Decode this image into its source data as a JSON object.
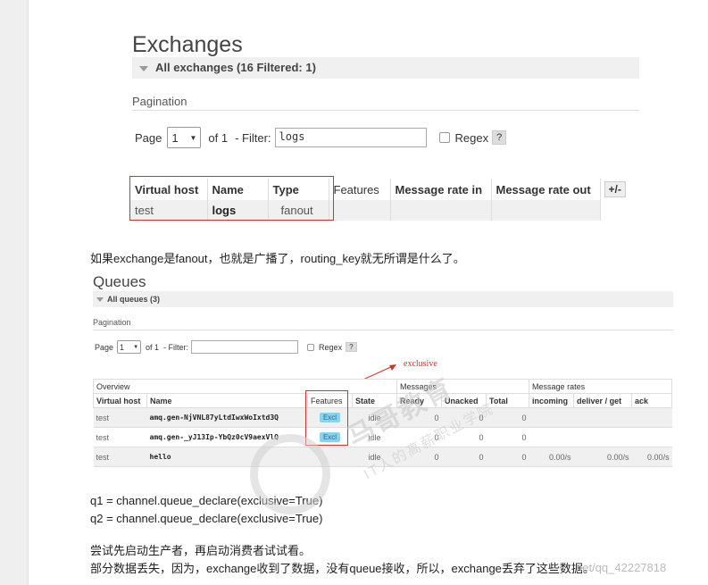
{
  "exchanges": {
    "title": "Exchanges",
    "filter_summary": "All exchanges (16 Filtered: 1)",
    "pagination_label": "Pagination",
    "page_label": "Page",
    "page_value": "1",
    "of_label": "of 1",
    "filter_label": "- Filter:",
    "filter_value": "logs",
    "regex_label": "Regex",
    "help_label": "?",
    "columns": [
      "Virtual host",
      "Name",
      "Type",
      "Features",
      "Message rate in",
      "Message rate out"
    ],
    "plus_minus": "+/-",
    "row": {
      "vhost": "test",
      "name": "logs",
      "type": "fanout",
      "features": "",
      "rate_in": "",
      "rate_out": ""
    }
  },
  "note1": "如果exchange是fanout，也就是广播了，routing_key就无所谓是什么了。",
  "queues": {
    "title": "Queues",
    "filter_summary": "All queues (3)",
    "pagination_label": "Pagination",
    "page_label": "Page",
    "page_value": "1",
    "of_label": "of 1",
    "filter_label": "- Filter:",
    "filter_value": "",
    "regex_label": "Regex",
    "help_label": "?",
    "groups": {
      "overview": "Overview",
      "messages": "Messages",
      "rates": "Message rates"
    },
    "columns": [
      "Virtual host",
      "Name",
      "Features",
      "State",
      "Ready",
      "Unacked",
      "Total",
      "incoming",
      "deliver / get",
      "ack"
    ],
    "rows": [
      {
        "vhost": "test",
        "name": "amq.gen-NjVNL87yLtdIwxWoIxtd3Q",
        "feature": "Excl",
        "state": "idle",
        "ready": "0",
        "unacked": "0",
        "total": "0",
        "incoming": "",
        "deliver": "",
        "ack": ""
      },
      {
        "vhost": "test",
        "name": "amq.gen-_yJ13Ip-YbQz0cV9aexVlQ",
        "feature": "Excl",
        "state": "idle",
        "ready": "0",
        "unacked": "0",
        "total": "0",
        "incoming": "",
        "deliver": "",
        "ack": ""
      },
      {
        "vhost": "test",
        "name": "hello",
        "feature": "",
        "state": "idle",
        "ready": "0",
        "unacked": "0",
        "total": "0",
        "incoming": "0.00/s",
        "deliver": "0.00/s",
        "ack": "0.00/s"
      }
    ],
    "annotation": "exclusive"
  },
  "code_lines": [
    "q1 = channel.queue_declare(exclusive=True)",
    "q2 = channel.queue_declare(exclusive=True)"
  ],
  "note2": "尝试先启动生产者，再启动消费者试试看。",
  "note3": "部分数据丢失，因为，exchange收到了数据，没有queue接收，所以，exchange丢弃了这些数据。",
  "watermark": {
    "brand": "马哥教育",
    "tagline": "IT人的高薪职业学院",
    "url": "net/qq_42227818"
  },
  "colors": {
    "highlight_red": "#d0342c",
    "excl_badge": "#8bd3ec"
  }
}
